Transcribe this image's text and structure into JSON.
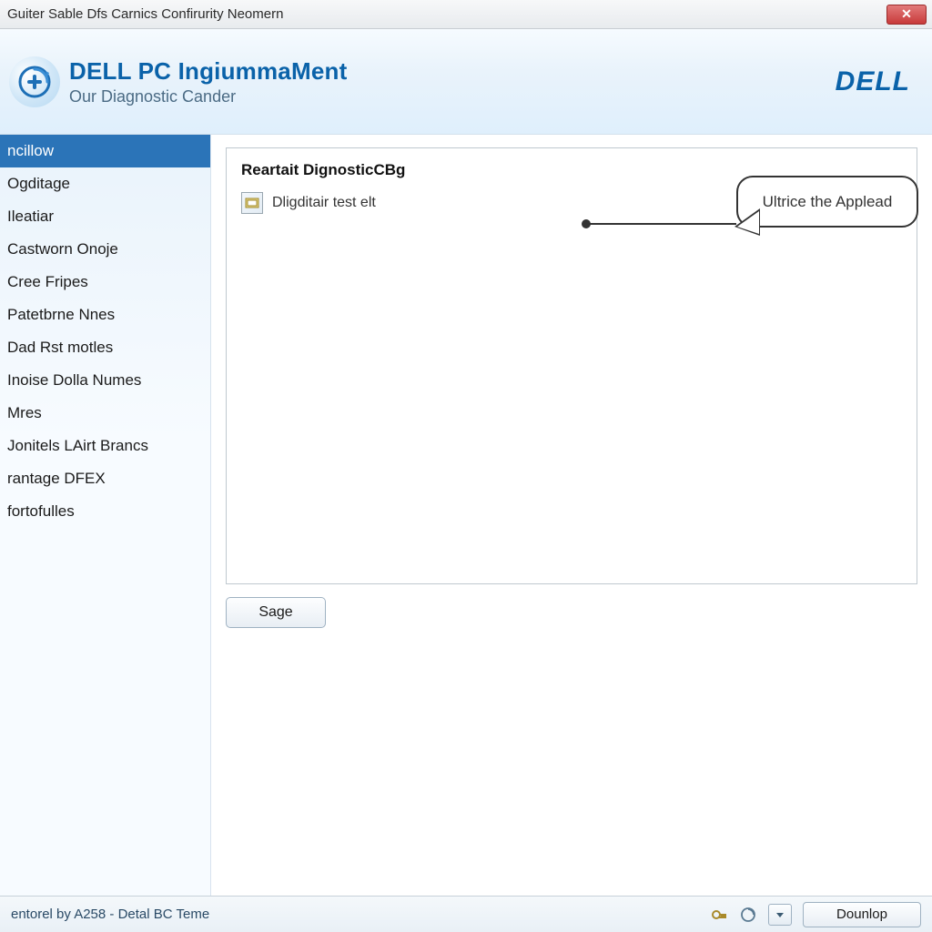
{
  "window": {
    "title": "Guiter Sable Dfs Carnics Confirurity Neomern"
  },
  "header": {
    "app_title": "DELL PC IngiummaMent",
    "subtitle": "Our Diagnostic Cander",
    "brand": "DELL"
  },
  "sidebar": {
    "items": [
      {
        "label": "ncillow",
        "selected": true
      },
      {
        "label": "Ogditage"
      },
      {
        "label": "Ileatiar"
      },
      {
        "label": "Castworn Onoje"
      },
      {
        "label": "Cree Fripes"
      },
      {
        "label": "Patetbrne Nnes"
      },
      {
        "label": "Dad Rst motles"
      },
      {
        "label": "Inoise Dolla Numes"
      },
      {
        "label": "Mres"
      },
      {
        "label": "Jonitels LAirt Brancs"
      },
      {
        "label": "rantage DFEX"
      },
      {
        "label": "fortofulles"
      }
    ]
  },
  "main": {
    "panel_title": "Reartait DignosticCBg",
    "test_label": "Dligditair test elt",
    "callout_text": "Ultrice the Applead",
    "action_button": "Sage"
  },
  "status": {
    "text": "entorel by A258 - Detal BC Teme",
    "footer_button": "Dounlop"
  },
  "colors": {
    "accent": "#0a62a9",
    "selected_bg": "#2b74b8"
  }
}
